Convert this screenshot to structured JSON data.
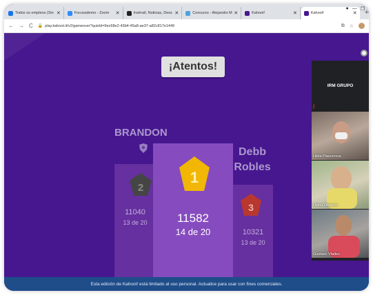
{
  "browser": {
    "tabs": [
      {
        "label": "Todos os empleos (Sin"
      },
      {
        "label": "Focussdemo - Zoom"
      },
      {
        "label": "Instrrail, Noticias, Dess"
      },
      {
        "label": "Concurso - Alejandro M"
      },
      {
        "label": "Kahoot!"
      },
      {
        "label": "Kahoot!"
      }
    ],
    "url": "play.kahoot.it/v2/gameover?quizId=9ec68e2-43b4-45a8-ae37-a82c817e1449"
  },
  "kahoot": {
    "header": "¡Atentos!",
    "podium": {
      "second": {
        "name": "BRANDON",
        "rank": "2",
        "score": "11040",
        "correct": "13 de 20"
      },
      "first": {
        "rank": "1",
        "score": "11582",
        "correct": "14 de 20"
      },
      "third": {
        "name": "Debb Robles",
        "rank": "3",
        "score": "10321",
        "correct": "13 de 20"
      }
    },
    "banner": "Esta edición de Kahoot! está limitado al uso personal. Actualice para usar con fines comerciales."
  },
  "meeting": {
    "header": "IRM GRUPO",
    "participants": [
      {
        "name": "Hilda Plascencia"
      },
      {
        "name": "Diana Olivarez"
      },
      {
        "name": "Gustavo Vladez"
      }
    ]
  },
  "colors": {
    "kahoot_purple": "#46178f",
    "podium_first": "#864cbf",
    "medal_gold": "#f2b705",
    "medal_silver": "#454545",
    "medal_bronze": "#b8372f",
    "banner": "#1f4d8a"
  }
}
